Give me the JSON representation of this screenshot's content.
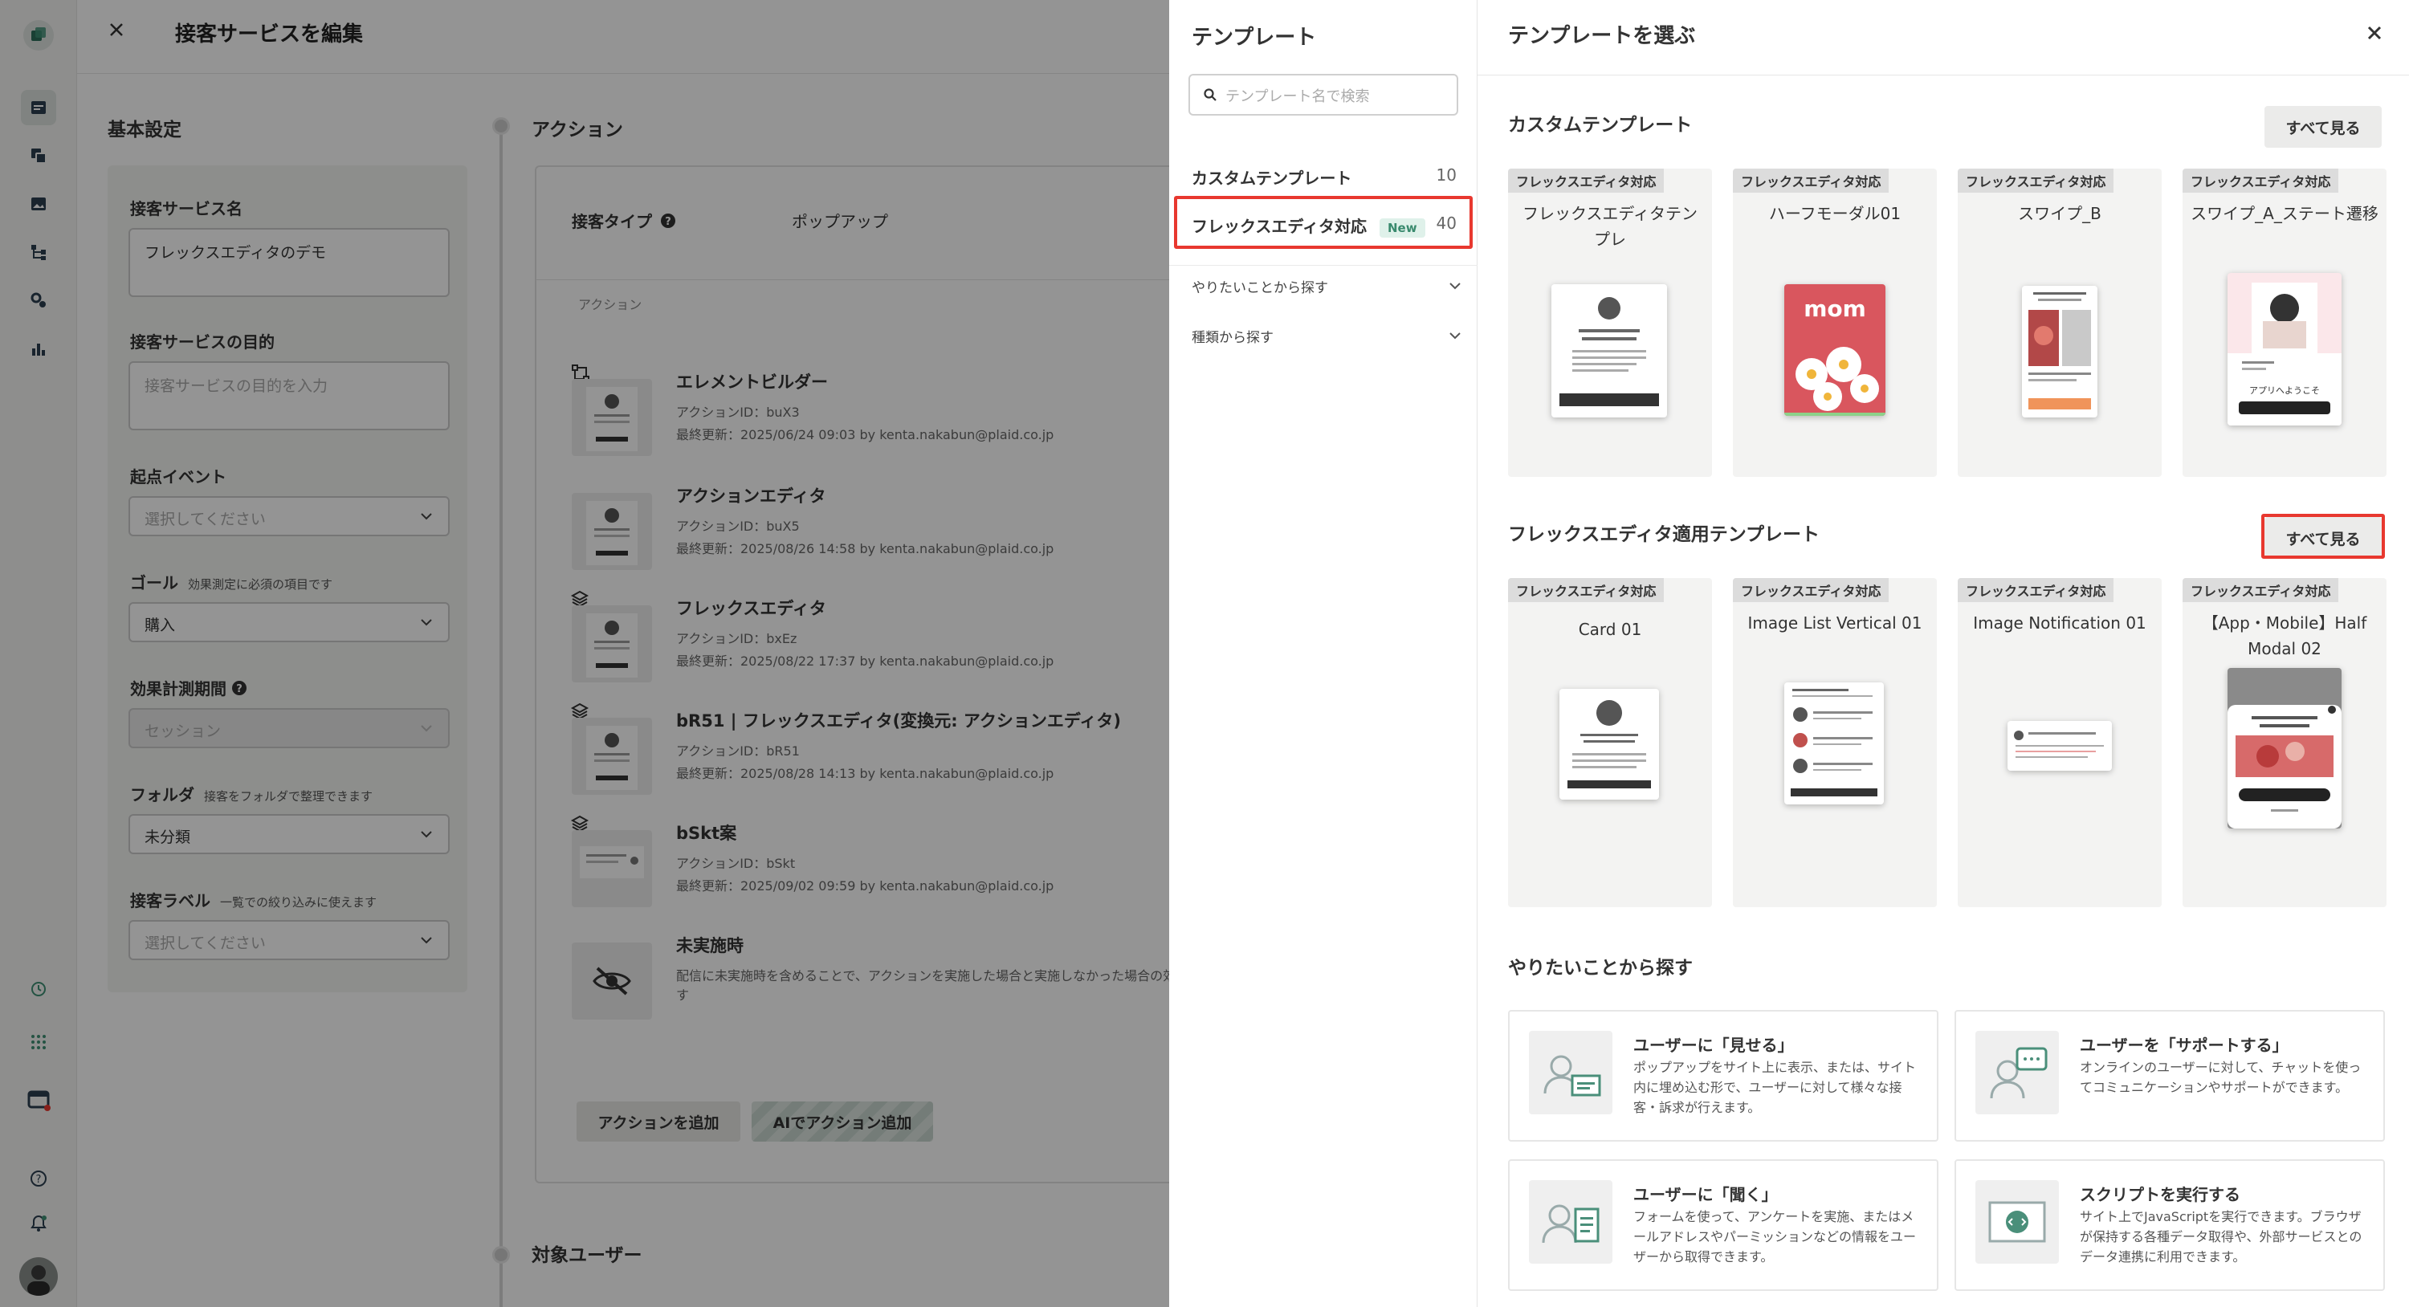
{
  "editor": {
    "title": "接客サービスを編集",
    "basic_section": "基本設定",
    "fields": {
      "name_label": "接客サービス名",
      "name_value": "フレックスエディタのデモ",
      "purpose_label": "接客サービスの目的",
      "purpose_placeholder": "接客サービスの目的を入力",
      "trigger_label": "起点イベント",
      "trigger_placeholder": "選択してください",
      "goal_label": "ゴール",
      "goal_hint": "効果測定に必須の項目です",
      "goal_value": "購入",
      "period_label": "効果計測期間",
      "period_value": "セッション",
      "folder_label": "フォルダ",
      "folder_hint": "接客をフォルダで整理できます",
      "folder_value": "未分類",
      "label_label": "接客ラベル",
      "label_hint": "一覧での絞り込みに使えます",
      "label_placeholder": "選択してください"
    },
    "action_section": "アクション",
    "action_type_label": "接客タイプ",
    "action_type_value": "ポップアップ",
    "action_list_header": "アクション",
    "actions": [
      {
        "name": "エレメントビルダー",
        "id": "アクションID：buX3",
        "updated": "最終更新：2025/06/24 09:03 by kenta.nakabun@plaid.co.jp"
      },
      {
        "name": "アクションエディタ",
        "id": "アクションID：buX5",
        "updated": "最終更新：2025/08/26 14:58 by kenta.nakabun@plaid.co.jp"
      },
      {
        "name": "フレックスエディタ",
        "id": "アクションID：bxEz",
        "updated": "最終更新：2025/08/22 17:37 by kenta.nakabun@plaid.co.jp"
      },
      {
        "name": "bR51 | フレックスエディタ(変換元: アクションエディタ)",
        "id": "アクションID：bR51",
        "updated": "最終更新：2025/08/28 14:13 by kenta.nakabun@plaid.co.jp"
      },
      {
        "name": "bSkt案",
        "id": "アクションID：bSkt",
        "updated": "最終更新：2025/09/02 09:59 by kenta.nakabun@plaid.co.jp"
      }
    ],
    "not_run": {
      "name": "未実施時",
      "desc1": "配信に未実施時を含めることで、アクションを実施した場合と実施しなかった場合の効",
      "desc2": "す"
    },
    "add_action_label": "アクションを追加",
    "ai_action_label": "AIでアクション追加",
    "target_section": "対象ユーザー"
  },
  "template_side": {
    "title": "テンプレート",
    "search_placeholder": "テンプレート名で検索",
    "items": [
      {
        "label": "カスタムテンプレート",
        "count": "10"
      },
      {
        "label": "フレックスエディタ対応",
        "badge": "New",
        "count": "40"
      }
    ],
    "accordions": [
      "やりたいことから探す",
      "種類から探す"
    ]
  },
  "template_main": {
    "title": "テンプレートを選ぶ",
    "see_all_label": "すべて見る",
    "custom_section": "カスタムテンプレート",
    "custom_cards": [
      {
        "tag": "フレックスエディタ対応",
        "name": "フレックスエディタテンプレ"
      },
      {
        "tag": "フレックスエディタ対応",
        "name": "ハーフモーダル01"
      },
      {
        "tag": "フレックスエディタ対応",
        "name": "スワイプ_B"
      },
      {
        "tag": "フレックスエディタ対応",
        "name": "スワイプ_A_ステート遷移"
      }
    ],
    "flex_section": "フレックスエディタ適用テンプレート",
    "flex_cards": [
      {
        "tag": "フレックスエディタ対応",
        "name": "Card 01"
      },
      {
        "tag": "フレックスエディタ対応",
        "name": "Image List Vertical 01"
      },
      {
        "tag": "フレックスエディタ対応",
        "name": "Image Notification 01"
      },
      {
        "tag": "フレックスエディタ対応",
        "name": "【App・Mobile】Half Modal 02"
      }
    ],
    "preview_texts": {
      "mom": "mom",
      "welcome": "アプリへようこそ"
    },
    "goal_section": "やりたいことから探す",
    "goals": [
      {
        "title": "ユーザーに「見せる」",
        "desc": "ポップアップをサイト上に表示、または、サイト内に埋め込む形で、ユーザーに対して様々な接客・訴求が行えます。"
      },
      {
        "title": "ユーザーを「サポートする」",
        "desc": "オンラインのユーザーに対して、チャットを使ってコミュニケーションやサポートができます。"
      },
      {
        "title": "ユーザーに「聞く」",
        "desc": "フォームを使って、アンケートを実施、またはメールアドレスやパーミッションなどの情報をユーザーから取得できます。"
      },
      {
        "title": "スクリプトを実行する",
        "desc": "サイト上でJavaScriptを実行できます。ブラウザが保持する各種データ取得や、外部サービスとのデータ連携に利用できます。"
      }
    ]
  },
  "colors": {
    "highlight": "#e8382f",
    "accent": "#2c6e5a"
  }
}
